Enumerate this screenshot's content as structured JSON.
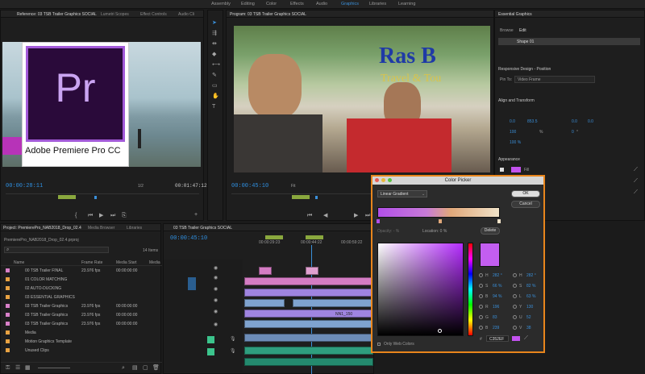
{
  "workspaces": [
    "Assembly",
    "Editing",
    "Color",
    "Effects",
    "Audio",
    "Graphics",
    "Libraries",
    "Learning"
  ],
  "active_workspace": "Graphics",
  "source_panel": {
    "tabs": [
      "Reference: 03 TSB Trailer Graphics SOCIAL",
      "Lumetri Scopes",
      "Effect Controls",
      "Audio Cli"
    ],
    "timecode_left": "00:00:28:11",
    "timecode_right": "00:01:47:12",
    "fit": "1/2"
  },
  "overlay_logo": {
    "letters": "Pr",
    "caption": "Adobe Premiere Pro CC"
  },
  "program_panel": {
    "title": "Program: 03 TSB Trailer Graphics SOCIAL",
    "timecode_left": "00:00:45:10",
    "fit": "Fit",
    "sign_text": "Ras B",
    "sign_sub": "Travel & Tou"
  },
  "essential_graphics": {
    "title": "Essential Graphics",
    "tabs": [
      "Browse",
      "Edit"
    ],
    "layer_name": "Shape 01",
    "responsive_heading": "Responsive Design - Position",
    "pin_to_label": "Pin To:",
    "pin_to_value": "Video Frame",
    "align_heading": "Align and Transform",
    "pos_x": "0.0",
    "pos_y": "853.5",
    "anchor_x": "0.0",
    "anchor_y": "0.0",
    "scale": "100",
    "scale_unit": "%",
    "rotation": "0",
    "rotation_unit": "°",
    "opacity": "100 %",
    "appearance_heading": "Appearance",
    "fill_label": "Fill"
  },
  "color_picker": {
    "title": "Color Picker",
    "mode": "Linear Gradient",
    "ok": "OK",
    "cancel": "Cancel",
    "opacity_label": "Opacity: - %",
    "location_label": "Location: 0 %",
    "delete": "Delete",
    "hsb": [
      {
        "label": "H",
        "value": "282 °"
      },
      {
        "label": "S",
        "value": "66 %"
      },
      {
        "label": "B",
        "value": "94 %"
      }
    ],
    "hsl": [
      {
        "label": "H",
        "value": "282 °"
      },
      {
        "label": "S",
        "value": "82 %"
      },
      {
        "label": "L",
        "value": "63 %"
      }
    ],
    "rgb": [
      {
        "label": "R",
        "value": "196"
      },
      {
        "label": "G",
        "value": "83"
      },
      {
        "label": "B",
        "value": "239"
      }
    ],
    "yuv": [
      {
        "label": "Y",
        "value": "130"
      },
      {
        "label": "U",
        "value": "52"
      },
      {
        "label": "V",
        "value": "38"
      }
    ],
    "hex_label": "#",
    "hex_value": "C352EF",
    "only_web": "Only Web Colors",
    "swatch_color": "#c352ef"
  },
  "project_panel": {
    "tabs": [
      "Project: PremierePro_NAB2018_Drop_02.4",
      "Media Browser",
      "Libraries"
    ],
    "path": "PremierePro_NAB2018_Drop_02.4.prproj",
    "item_count": "14 Items",
    "columns": [
      "Name",
      "Frame Rate",
      "Media Start",
      "Media"
    ],
    "rows": [
      {
        "name": "00 TSB Trailer FINAL",
        "fr": "23.976 fps",
        "ms": "00:00:00:00",
        "color": "#d880c8"
      },
      {
        "name": "01 COLOR MATCHING",
        "fr": "",
        "ms": "",
        "color": "#e8a242"
      },
      {
        "name": "02 AUTO-DUCKING",
        "fr": "",
        "ms": "",
        "color": "#e8a242"
      },
      {
        "name": "03 ESSENTIAL GRAPHICS",
        "fr": "",
        "ms": "",
        "color": "#e8a242"
      },
      {
        "name": "03 TSB Trailer Graphics",
        "fr": "23.976 fps",
        "ms": "00:00:00:00",
        "color": "#d880c8"
      },
      {
        "name": "03 TSB Trailer Graphics",
        "fr": "23.976 fps",
        "ms": "00:00:00:00",
        "color": "#d880c8"
      },
      {
        "name": "03 TSB Trailer Graphics",
        "fr": "23.976 fps",
        "ms": "00:00:00:00",
        "color": "#d880c8"
      },
      {
        "name": "Media",
        "fr": "",
        "ms": "",
        "color": "#e8a242"
      },
      {
        "name": "Motion Graphics Template",
        "fr": "",
        "ms": "",
        "color": "#e8a242"
      },
      {
        "name": "Unused Clips",
        "fr": "",
        "ms": "",
        "color": "#e8a242"
      }
    ]
  },
  "timeline": {
    "title": "03 TSB Trailer Graphics SOCIAL",
    "timecode": "00:00:45:10",
    "ruler": [
      "00:00:29:23",
      "00:00:44:22",
      "00:00:59:22"
    ],
    "clip_label": "NN1_150"
  }
}
